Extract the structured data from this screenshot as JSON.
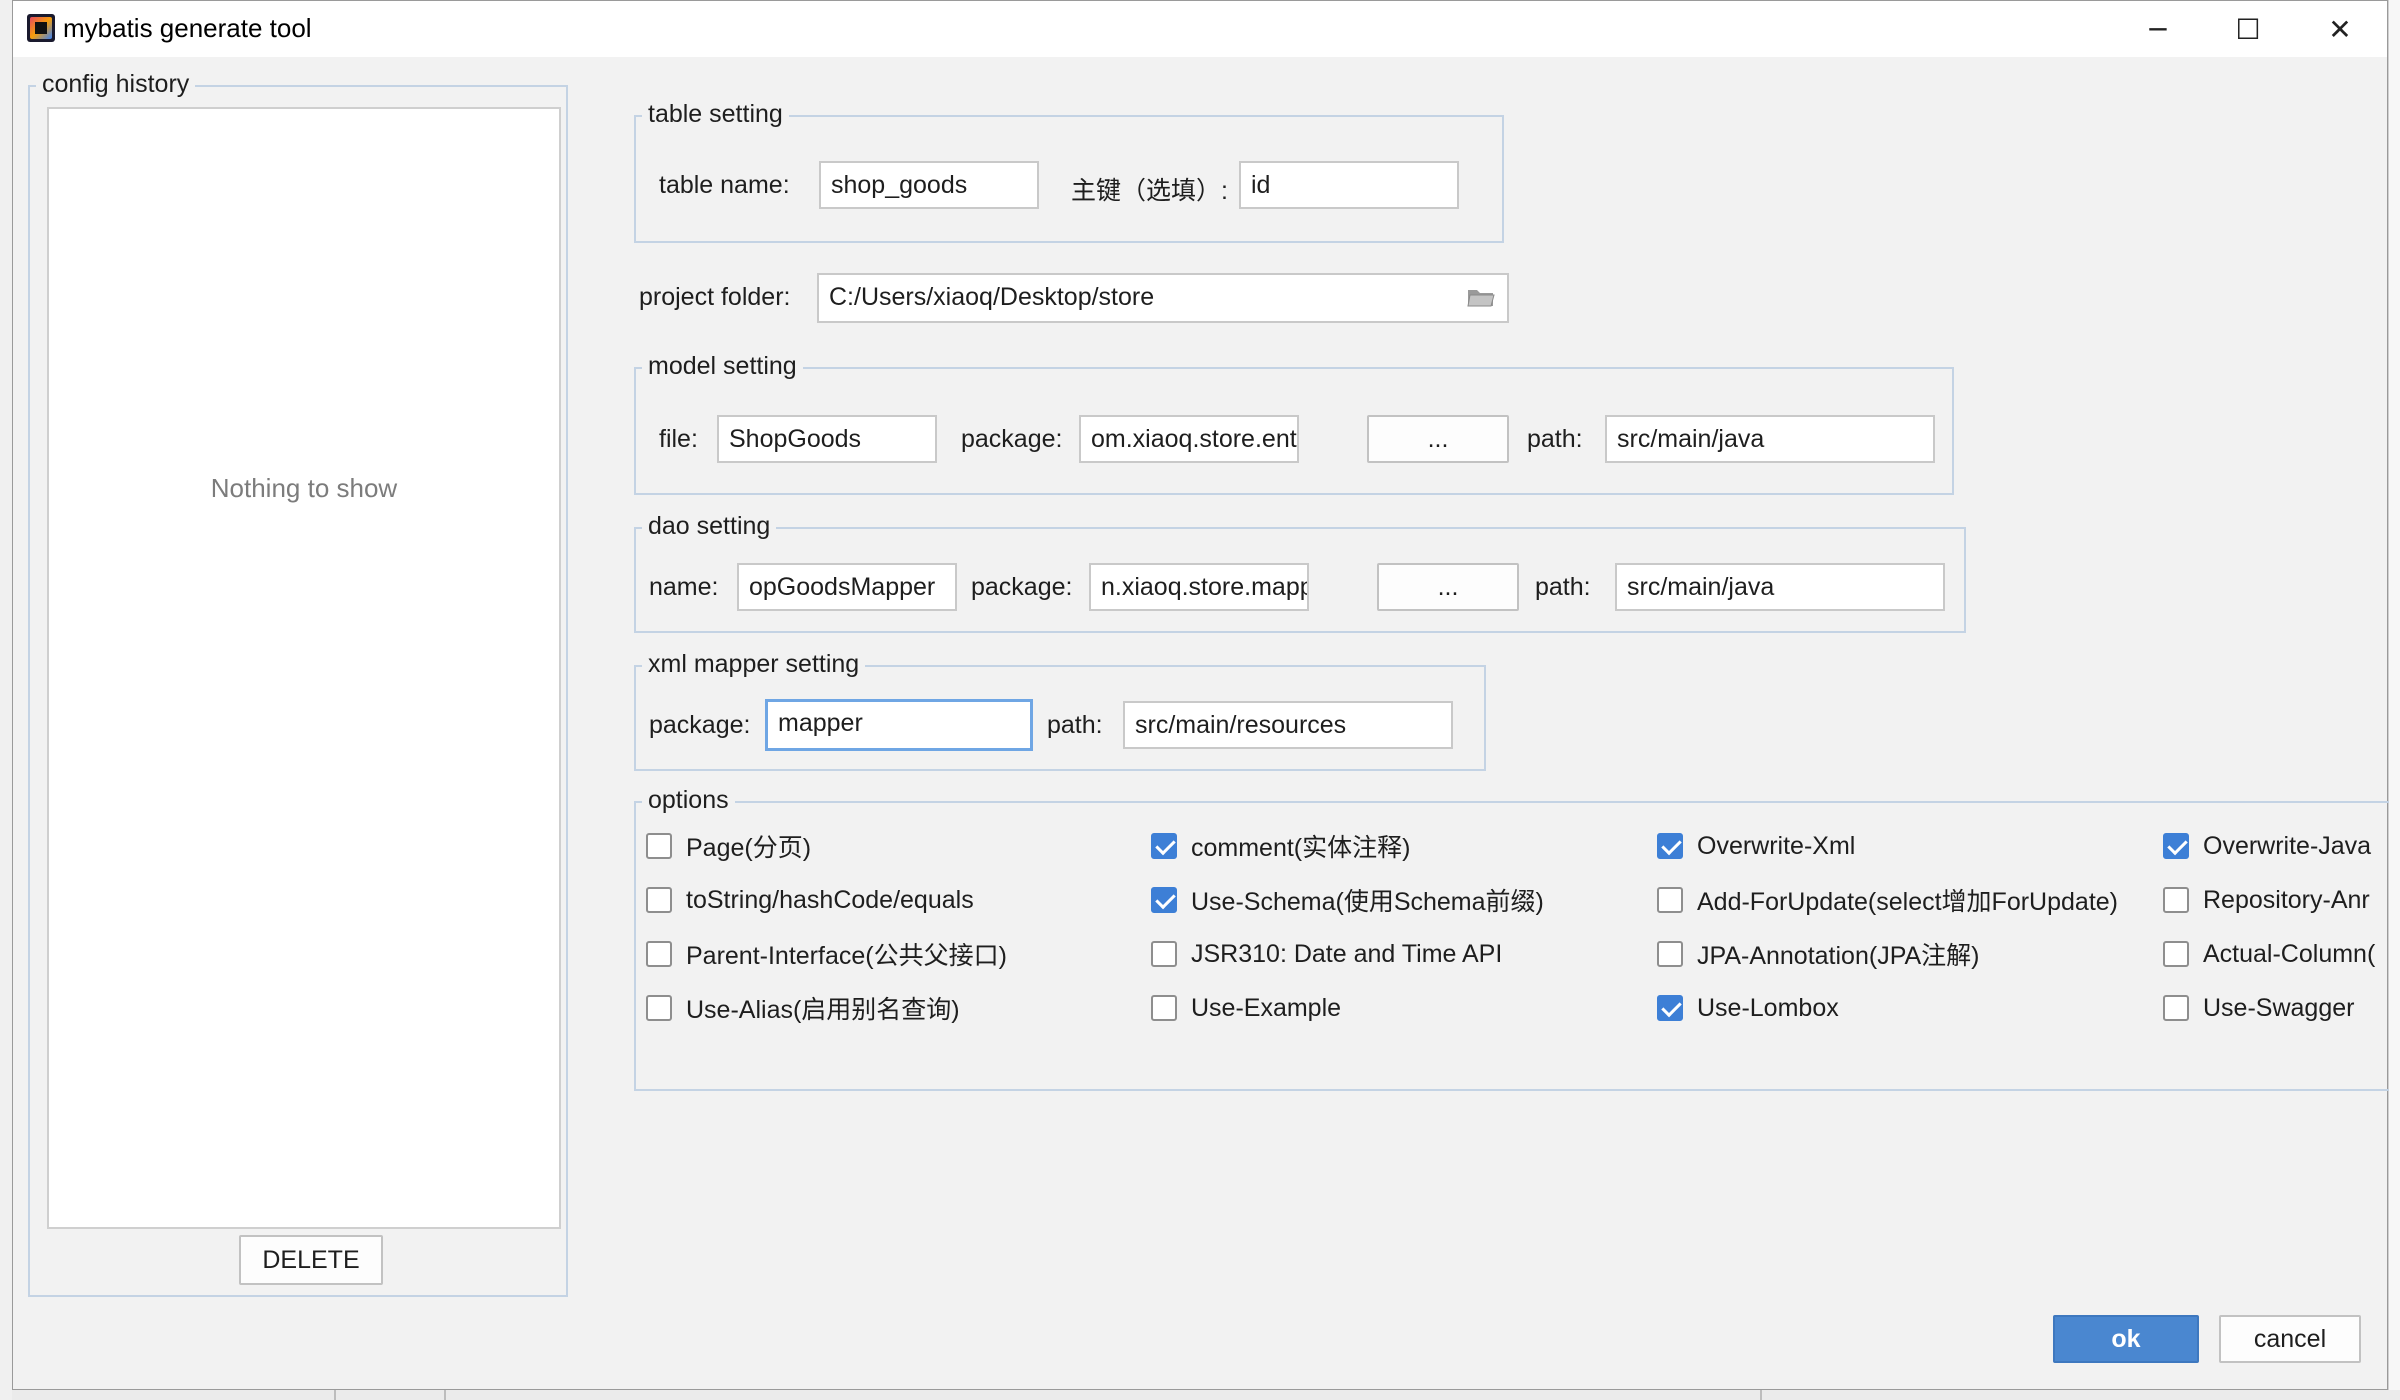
{
  "window": {
    "title": "mybatis generate tool",
    "controls": {
      "minimize": "─",
      "maximize": "☐",
      "close": "✕"
    }
  },
  "config_history": {
    "legend": "config history",
    "empty_text": "Nothing to show",
    "delete_label": "DELETE"
  },
  "table_setting": {
    "legend": "table setting",
    "table_name_label": "table  name:",
    "table_name_value": "shop_goods",
    "primary_key_label": "主键（选填）:",
    "primary_key_value": "id"
  },
  "project": {
    "label": "project folder:",
    "value": "C:/Users/xiaoq/Desktop/store"
  },
  "model_setting": {
    "legend": "model setting",
    "file_label": "file:",
    "file_value": "ShopGoods",
    "package_label": "package:",
    "package_value": "om.xiaoq.store.entity",
    "browse_label": "...",
    "path_label": "path:",
    "path_value": "src/main/java"
  },
  "dao_setting": {
    "legend": "dao setting",
    "name_label": "name:",
    "name_value": "opGoodsMapper",
    "package_label": "package:",
    "package_value": "n.xiaoq.store.mapper",
    "browse_label": "...",
    "path_label": "path:",
    "path_value": "src/main/java"
  },
  "xml_setting": {
    "legend": "xml mapper setting",
    "package_label": "package:",
    "package_value": "mapper",
    "path_label": "path:",
    "path_value": "src/main/resources"
  },
  "options": {
    "legend": "options",
    "items": [
      {
        "label": "Page(分页)",
        "checked": false
      },
      {
        "label": "comment(实体注释)",
        "checked": true
      },
      {
        "label": "Overwrite-Xml",
        "checked": true
      },
      {
        "label": "Overwrite-Java",
        "checked": true
      },
      {
        "label": "toString/hashCode/equals",
        "checked": false
      },
      {
        "label": "Use-Schema(使用Schema前缀)",
        "checked": true
      },
      {
        "label": "Add-ForUpdate(select增加ForUpdate)",
        "checked": false
      },
      {
        "label": "Repository-Anr",
        "checked": false
      },
      {
        "label": "Parent-Interface(公共父接口)",
        "checked": false
      },
      {
        "label": "JSR310: Date and Time API",
        "checked": false
      },
      {
        "label": "JPA-Annotation(JPA注解)",
        "checked": false
      },
      {
        "label": "Actual-Column(",
        "checked": false
      },
      {
        "label": "Use-Alias(启用别名查询)",
        "checked": false
      },
      {
        "label": "Use-Example",
        "checked": false
      },
      {
        "label": "Use-Lombox",
        "checked": true
      },
      {
        "label": "Use-Swagger",
        "checked": false
      }
    ]
  },
  "footer": {
    "ok_label": "ok",
    "cancel_label": "cancel"
  },
  "colors": {
    "accent": "#4a87d0",
    "checkbox_on": "#3d7fd6",
    "group_border": "#c4d3e4",
    "window_bg": "#f2f2f2"
  }
}
